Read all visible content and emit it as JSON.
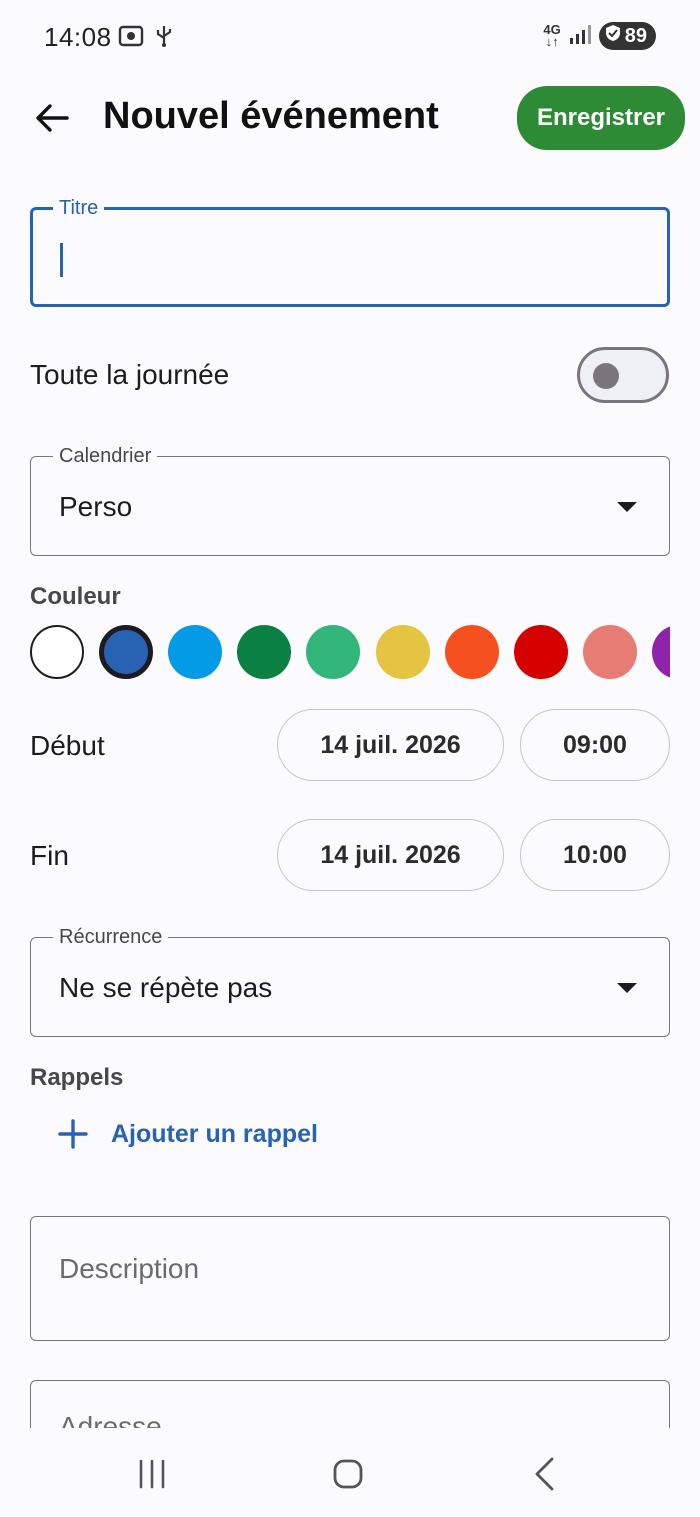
{
  "status_bar": {
    "time": "14:08",
    "network": "4G",
    "battery": "89"
  },
  "header": {
    "title": "Nouvel événement",
    "save_label": "Enregistrer"
  },
  "title_field": {
    "label": "Titre",
    "value": ""
  },
  "all_day": {
    "label": "Toute la journée",
    "enabled": false
  },
  "calendar": {
    "label": "Calendrier",
    "value": "Perso"
  },
  "colors": {
    "label": "Couleur",
    "selected": "#2862b2",
    "options": [
      "#ffffff",
      "#2862b2",
      "#039be5",
      "#0b8043",
      "#33b679",
      "#e4c441",
      "#f4511e",
      "#d50000",
      "#e67c73",
      "#8e24aa"
    ]
  },
  "start": {
    "label": "Début",
    "date": "14 juil. 2026",
    "time": "09:00"
  },
  "end": {
    "label": "Fin",
    "date": "14 juil. 2026",
    "time": "10:00"
  },
  "recurrence": {
    "label": "Récurrence",
    "value": "Ne se répète pas"
  },
  "reminders": {
    "label": "Rappels",
    "add_label": "Ajouter un rappel"
  },
  "description": {
    "placeholder": "Description"
  },
  "address": {
    "placeholder": "Adresse"
  },
  "accent_color": "#2862b2",
  "save_color": "#2d8b36"
}
